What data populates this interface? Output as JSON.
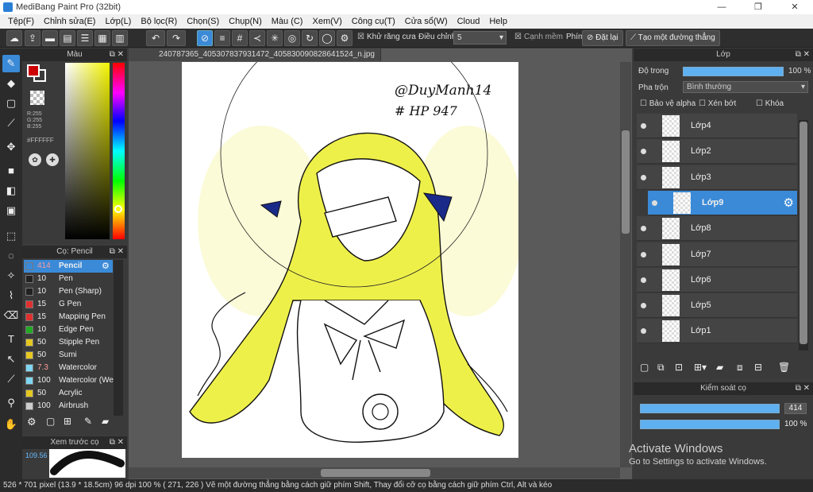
{
  "window": {
    "title": "MediBang Paint Pro (32bit)",
    "buttons": {
      "minimize": "—",
      "maximize": "❐",
      "close": "✕"
    }
  },
  "menu": [
    "Tệp(F)",
    "Chỉnh sửa(E)",
    "Lớp(L)",
    "Bộ lọc(R)",
    "Chọn(S)",
    "Chụp(N)",
    "Màu (C)",
    "Xem(V)",
    "Công cụ(T)",
    "Cửa sổ(W)",
    "Cloud",
    "Help"
  ],
  "toolbar": {
    "antialias_label": "Khử răng cưa",
    "adjust_label": "Điều chỉnh",
    "adjust_value": "5",
    "soft_edge_label": "Cạnh mềm",
    "key_label": "Phím",
    "reset_label": "Đặt lại",
    "straight_line_label": "Tạo một đường thẳng"
  },
  "color_panel": {
    "title": "Màu",
    "rgb": {
      "r": "R:255",
      "g": "G:255",
      "b": "B:255"
    },
    "hex": "#FFFFFF",
    "foreground": "#cc0000",
    "background": "#ffffff"
  },
  "brush_panel": {
    "title": "Cọ: Pencil",
    "items": [
      {
        "size": "414",
        "name": "Pencil",
        "color": "#3a8ad8",
        "selected": true
      },
      {
        "size": "10",
        "name": "Pen",
        "color": "#222222"
      },
      {
        "size": "10",
        "name": "Pen (Sharp)",
        "color": "#222222"
      },
      {
        "size": "15",
        "name": "G Pen",
        "color": "#e03030"
      },
      {
        "size": "15",
        "name": "Mapping Pen",
        "color": "#e03030"
      },
      {
        "size": "10",
        "name": "Edge Pen",
        "color": "#22aa22"
      },
      {
        "size": "50",
        "name": "Stipple Pen",
        "color": "#e6c820"
      },
      {
        "size": "50",
        "name": "Sumi",
        "color": "#e6c820"
      },
      {
        "size": "7.3",
        "name": "Watercolor",
        "color": "#7fd6f0"
      },
      {
        "size": "100",
        "name": "Watercolor (We",
        "color": "#7fd6f0"
      },
      {
        "size": "50",
        "name": "Acrylic",
        "color": "#e6c820"
      },
      {
        "size": "100",
        "name": "Airbrush",
        "color": "#cccccc"
      }
    ]
  },
  "preview_panel": {
    "title": "Xem trước cọ",
    "value": "109.56"
  },
  "document": {
    "tab_name": "240787365_405307837931472_405830090828641524_n.jpg",
    "handwriting_1": "@DuyManh14",
    "handwriting_2": "# HP 947"
  },
  "layer_panel": {
    "title": "Lớp",
    "opacity_label": "Độ trong",
    "opacity_value": "100 %",
    "blend_label": "Pha trộn",
    "blend_value": "Bình thường",
    "protect_alpha": "Bảo vệ alpha",
    "clipping": "Xén bớt",
    "lock": "Khóa",
    "layers": [
      {
        "name": "Lớp4"
      },
      {
        "name": "Lớp2"
      },
      {
        "name": "Lớp3"
      },
      {
        "name": "Lớp9",
        "selected": true
      },
      {
        "name": "Lớp8"
      },
      {
        "name": "Lớp7"
      },
      {
        "name": "Lớp6"
      },
      {
        "name": "Lớp5"
      },
      {
        "name": "Lớp1"
      }
    ]
  },
  "brush_control": {
    "title": "Kiểm soát cọ",
    "size_value": "414",
    "opacity_value": "100 %"
  },
  "status": {
    "text": "526 * 701 pixel   (13.9 * 18.5cm)   96 dpi   100 %   ( 271, 226 )   Vẽ một đường thẳng bằng cách giữ phím Shift, Thay đổi cỡ cọ bằng cách giữ phím Ctrl, Alt và kéo"
  },
  "watermark": {
    "line1": "Activate Windows",
    "line2": "Go to Settings to activate Windows."
  }
}
